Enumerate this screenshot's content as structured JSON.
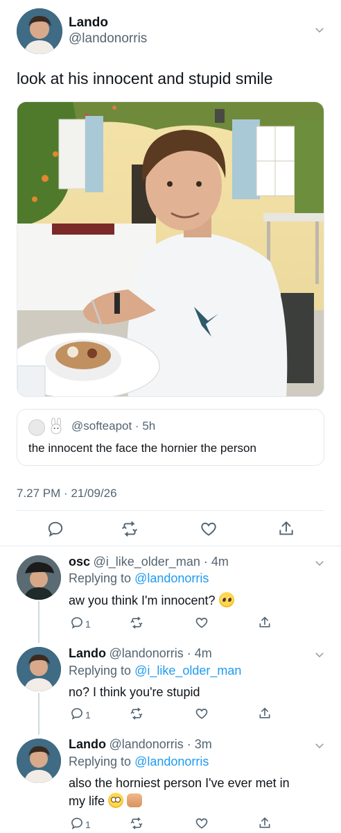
{
  "tweet": {
    "author_name": "Lando",
    "author_handle": "@landonorris",
    "text": "look at his innocent and stupid smile",
    "quote": {
      "handle": "@softeapot",
      "time": "5h",
      "text": "the innocent the face the hornier the person"
    },
    "timestamp": "7.27 PM · 21/09/26",
    "actions": [
      "reply-icon",
      "retweet-icon",
      "like-icon",
      "share-icon"
    ]
  },
  "replies": [
    {
      "name": "osc",
      "handle": "@i_like_older_man",
      "time": "4m",
      "replying_label": "Replying to",
      "replying_to": "@landonorris",
      "text": "aw you think I'm innocent?",
      "reply_count": "1",
      "emoji": [
        "pleading-face-emoji"
      ]
    },
    {
      "name": "Lando",
      "handle": "@landonorris",
      "time": "4m",
      "replying_label": "Replying to",
      "replying_to": "@i_like_older_man",
      "text": "no? I think you're stupid",
      "reply_count": "1"
    },
    {
      "name": "Lando",
      "handle": "@landonorris",
      "time": "3m",
      "replying_label": "Replying to",
      "replying_to": "@landonorris",
      "text_line1": "also the horniest person I've ever met in",
      "text_line2": "my life",
      "reply_count": "1",
      "emoji": [
        "face-with-rolling-eyes-emoji",
        "fist-emoji"
      ]
    }
  ],
  "colors": {
    "link": "#1d9bf0",
    "secondary": "#536471",
    "primary": "#0f1419",
    "divider": "#e6ecf0"
  }
}
